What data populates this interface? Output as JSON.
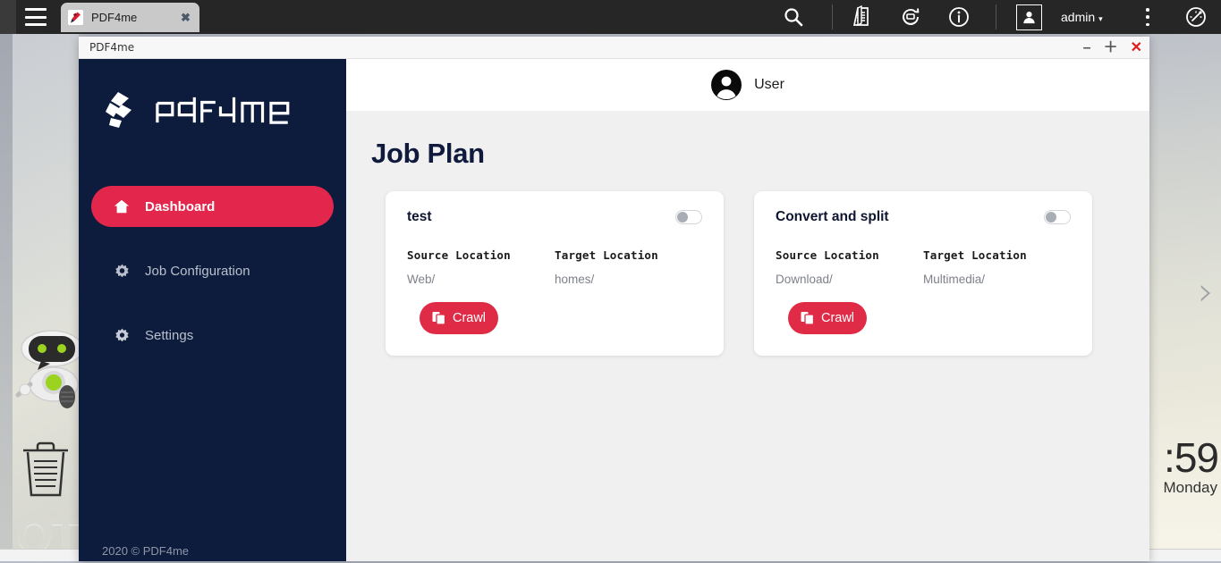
{
  "browser": {
    "menu_icon": "hamburger-icon",
    "tab": {
      "title": "PDF4me",
      "favicon": "pdf4me-favicon",
      "close_label": "✖"
    },
    "toolbar": {
      "search_icon": "search-icon",
      "documents_icon": "documents-icon",
      "sync_icon": "sync-icon",
      "info_icon": "info-icon",
      "user_icon": "user-box-icon",
      "account_label": "admin",
      "account_caret": "▾",
      "kebab_icon": "more-options-icon",
      "gauge_icon": "speedometer-icon"
    }
  },
  "window": {
    "title": "PDF4me",
    "minimize_label": "–",
    "maximize_label": "＋",
    "close_label": "✕"
  },
  "sidebar": {
    "logo_text": "pdf4me",
    "items": [
      {
        "label": "Dashboard",
        "icon": "home-icon",
        "active": true
      },
      {
        "label": "Job Configuration",
        "icon": "gear-icon",
        "active": false
      },
      {
        "label": "Settings",
        "icon": "gear-icon",
        "active": false
      }
    ],
    "footer": "2020 © PDF4me"
  },
  "header": {
    "user_label": "User",
    "avatar_icon": "user-avatar-icon"
  },
  "main": {
    "page_title": "Job Plan",
    "labels": {
      "source_location": "Source Location",
      "target_location": "Target Location",
      "crawl": "Crawl"
    },
    "cards": [
      {
        "title": "test",
        "enabled": false,
        "source_location": "Web/",
        "target_location": "homes/",
        "action_label": "Crawl"
      },
      {
        "title": "Convert and split",
        "enabled": false,
        "source_location": "Download/",
        "target_location": "Multimedia/",
        "action_label": "Crawl"
      }
    ]
  },
  "desktop": {
    "clock_time": ":59",
    "clock_day": "Monday",
    "next_arrow": "›",
    "qt_logo": "QT",
    "robot_icon": "robot-mascot-icon",
    "trash_icon": "trash-bin-icon"
  },
  "colors": {
    "accent": "#e3264b",
    "sidebar_bg": "#0d1b3d",
    "main_bg": "#f0f0f0",
    "title_color": "#101a3c"
  }
}
